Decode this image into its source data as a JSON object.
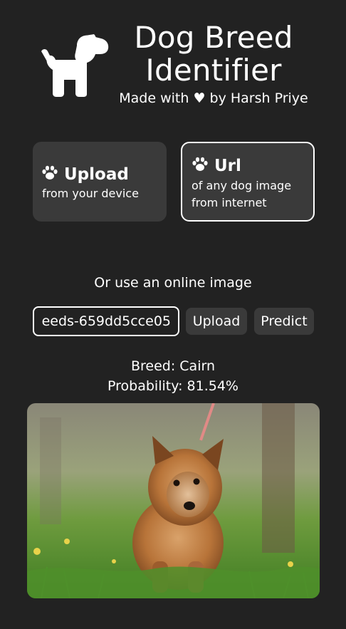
{
  "header": {
    "title": "Dog Breed Identifier",
    "subtitle": "Made with ♥ by Harsh Priye",
    "logo_icon": "dog-icon"
  },
  "modes": [
    {
      "title": "Upload",
      "description": "from your device",
      "icon": "paw-icon",
      "selected": false
    },
    {
      "title": "Url",
      "description": "of any dog image from internet",
      "icon": "paw-icon",
      "selected": true
    }
  ],
  "online": {
    "label": "Or use an online image",
    "url_value": "eeds-659dd5cce05",
    "upload_label": "Upload",
    "predict_label": "Predict"
  },
  "result": {
    "breed_line": "Breed: Cairn",
    "probability_line": "Probability: 81.54%"
  },
  "colors": {
    "background": "#222222",
    "card": "#3a3a3a",
    "text": "#ffffff"
  }
}
